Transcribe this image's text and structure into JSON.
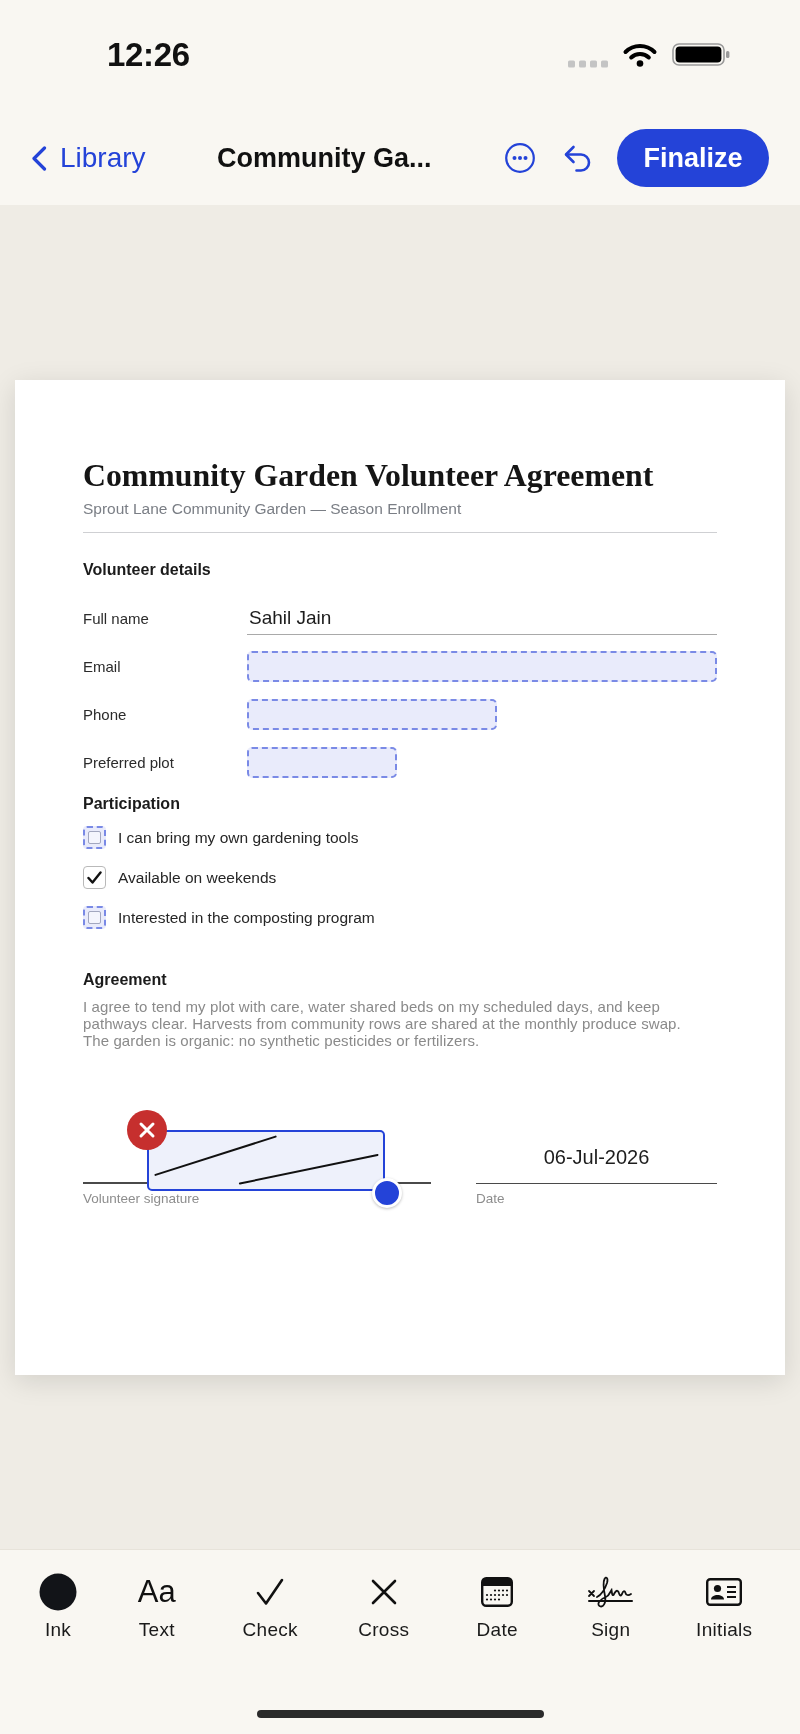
{
  "status_bar": {
    "time": "12:26"
  },
  "nav_bar": {
    "back_label": "Library",
    "title": "Community Ga...",
    "action": "Finalize"
  },
  "document": {
    "title": "Community Garden Volunteer Agreement",
    "subtitle": "Sprout Lane Community Garden — Season Enrollment",
    "details": {
      "heading": "Volunteer details",
      "fields": [
        {
          "label": "Full name",
          "value": "Sahil Jain"
        },
        {
          "label": "Email"
        },
        {
          "label": "Phone"
        },
        {
          "label": "Preferred plot"
        }
      ]
    },
    "participation": {
      "heading": "Participation",
      "options": [
        {
          "label": "I can bring my own gardening tools",
          "checked": false
        },
        {
          "label": "Available on weekends",
          "checked": true
        },
        {
          "label": "Interested in the composting program",
          "checked": false
        }
      ]
    },
    "agreement": {
      "heading": "Agreement",
      "text": "I agree to tend my plot with care, water shared beds on my scheduled days, and keep pathways clear. Harvests from community rows are shared at the monthly produce swap. The garden is organic: no synthetic pesticides or fertilizers."
    },
    "signature": {
      "label": "Volunteer signature",
      "signed": true,
      "selected": true
    },
    "date": {
      "label": "Date",
      "value": "06-Jul-2026"
    }
  },
  "toolbar": [
    {
      "kind": "ink",
      "label": "Ink"
    },
    {
      "kind": "text",
      "label": "Text",
      "glyph": "Aa"
    },
    {
      "kind": "check",
      "label": "Check"
    },
    {
      "kind": "cross",
      "label": "Cross"
    },
    {
      "kind": "date",
      "label": "Date"
    },
    {
      "kind": "sign",
      "label": "Sign"
    },
    {
      "kind": "initials",
      "label": "Initials"
    }
  ]
}
